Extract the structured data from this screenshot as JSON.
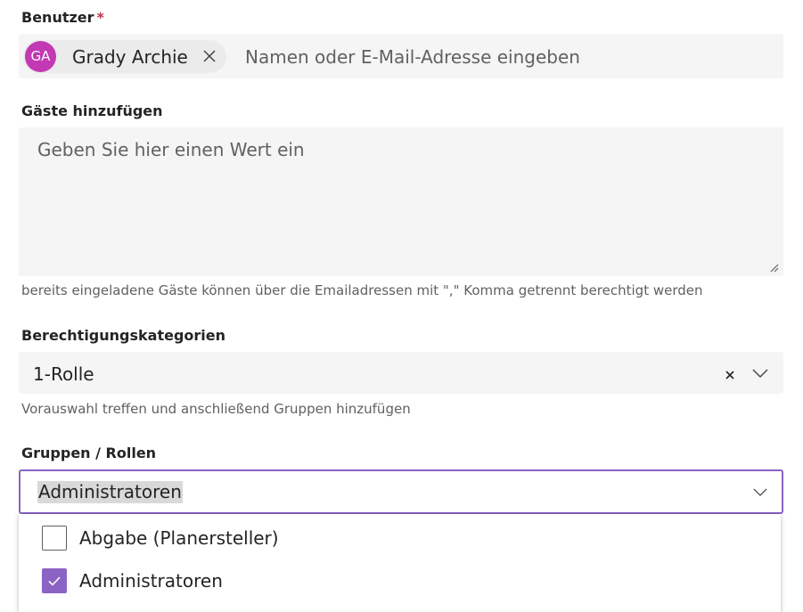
{
  "users_field": {
    "label": "Benutzer",
    "required_mark": "*",
    "selected_person": {
      "initials": "GA",
      "name": "Grady Archie",
      "avatar_color": "#c239b3"
    },
    "placeholder": "Namen oder E-Mail-Adresse eingeben",
    "remove_icon": "close-icon"
  },
  "guests_field": {
    "label": "Gäste hinzufügen",
    "placeholder": "Geben Sie hier einen Wert ein",
    "hint": "bereits eingeladene Gäste können über die Emailadressen mit \",\" Komma getrennt berechtigt werden"
  },
  "category_field": {
    "label": "Berechtigungskategorien",
    "value": "1-Rolle",
    "hint": "Vorauswahl treffen und anschließend Gruppen hinzufügen",
    "clear_icon": "close-icon",
    "expand_icon": "chevron-down-icon"
  },
  "groups_field": {
    "label": "Gruppen / Rollen",
    "value": "Administratoren",
    "expand_icon": "chevron-down-icon",
    "options": [
      {
        "label": "Abgabe (Planersteller)",
        "checked": false
      },
      {
        "label": "Administratoren",
        "checked": true
      }
    ]
  },
  "colors": {
    "accent": "#8a63c4",
    "required": "#c4314b",
    "field_background": "#f5f5f5",
    "pill_background": "#ebebeb"
  }
}
